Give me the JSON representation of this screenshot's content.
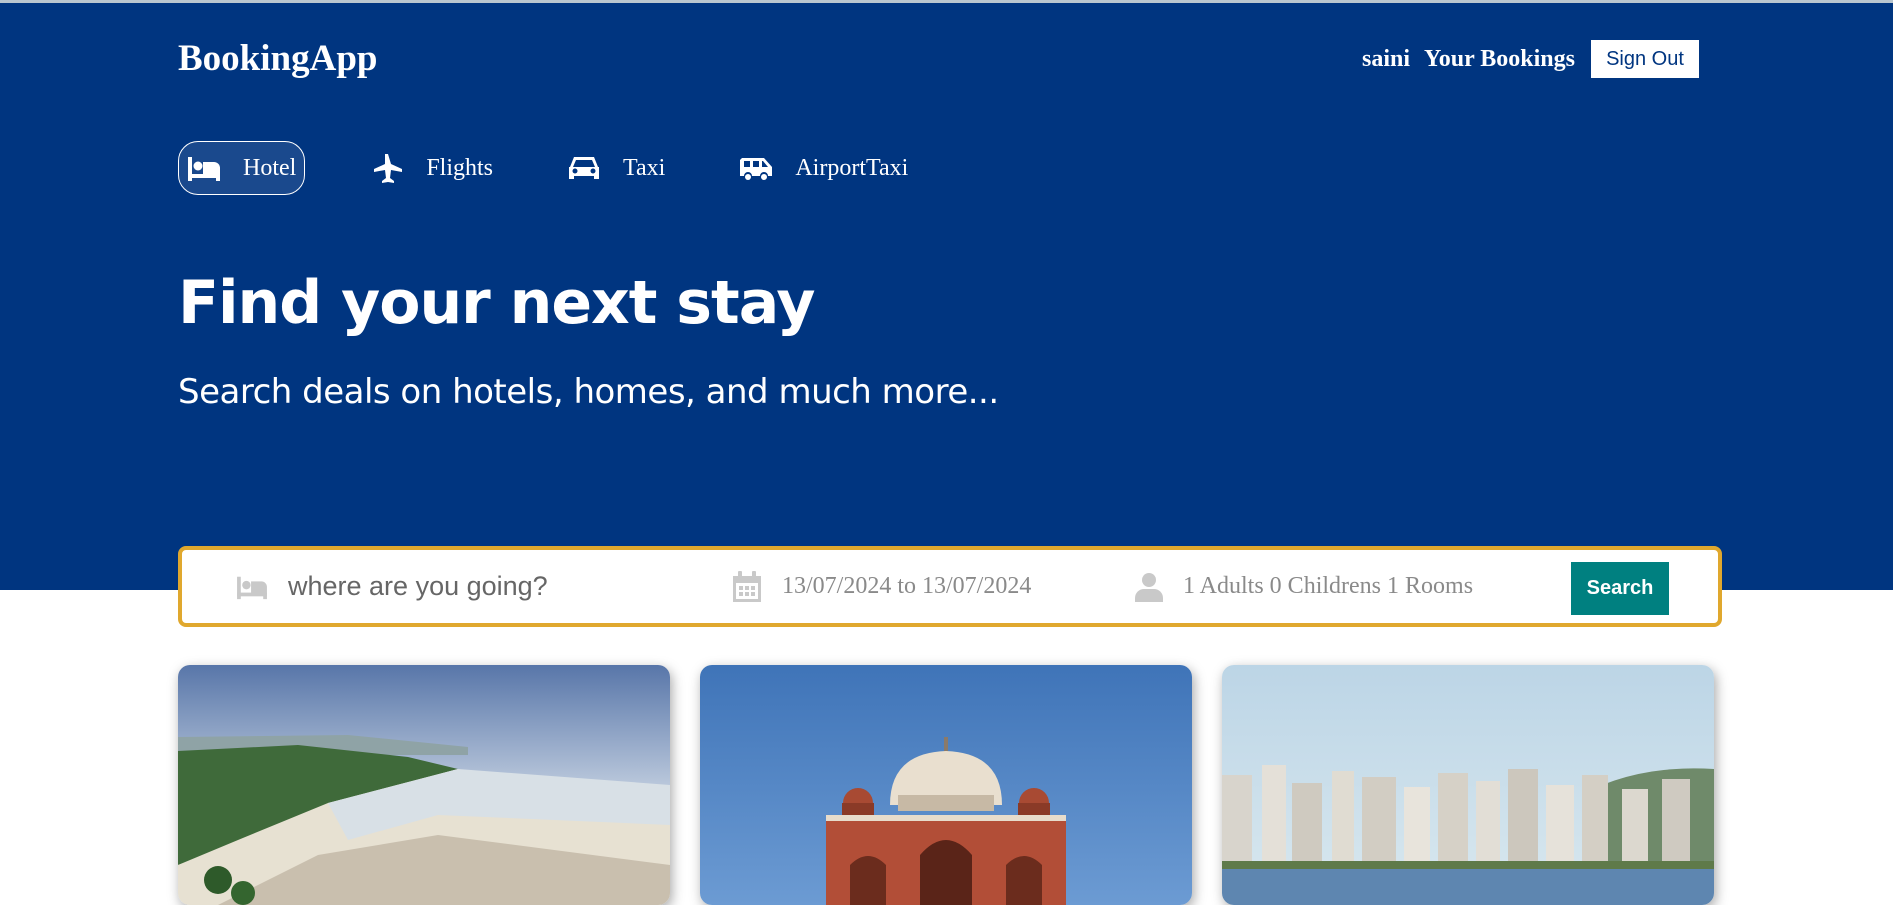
{
  "header": {
    "logo": "BookingApp",
    "username": "saini",
    "your_bookings": "Your Bookings",
    "sign_out": "Sign Out"
  },
  "services": [
    {
      "label": "Hotel",
      "icon": "bed-icon",
      "active": true
    },
    {
      "label": "Flights",
      "icon": "plane-icon",
      "active": false
    },
    {
      "label": "Taxi",
      "icon": "car-icon",
      "active": false
    },
    {
      "label": "AirportTaxi",
      "icon": "shuttle-icon",
      "active": false
    }
  ],
  "hero": {
    "title": "Find your next stay",
    "subtitle": "Search deals on hotels, homes, and much more..."
  },
  "search": {
    "destination_placeholder": "where are you going?",
    "destination_value": "",
    "date_range": "13/07/2024 to 13/07/2024",
    "guests": "1 Adults 0 Childrens 1 Rooms",
    "button_label": "Search"
  },
  "cards": [
    {
      "image": "beach-coastline-photo"
    },
    {
      "image": "humayuns-tomb-photo"
    },
    {
      "image": "city-skyline-waterfront-photo"
    }
  ],
  "colors": {
    "brand_blue": "#003580",
    "search_border": "#e0a82e",
    "search_button": "#008080"
  }
}
